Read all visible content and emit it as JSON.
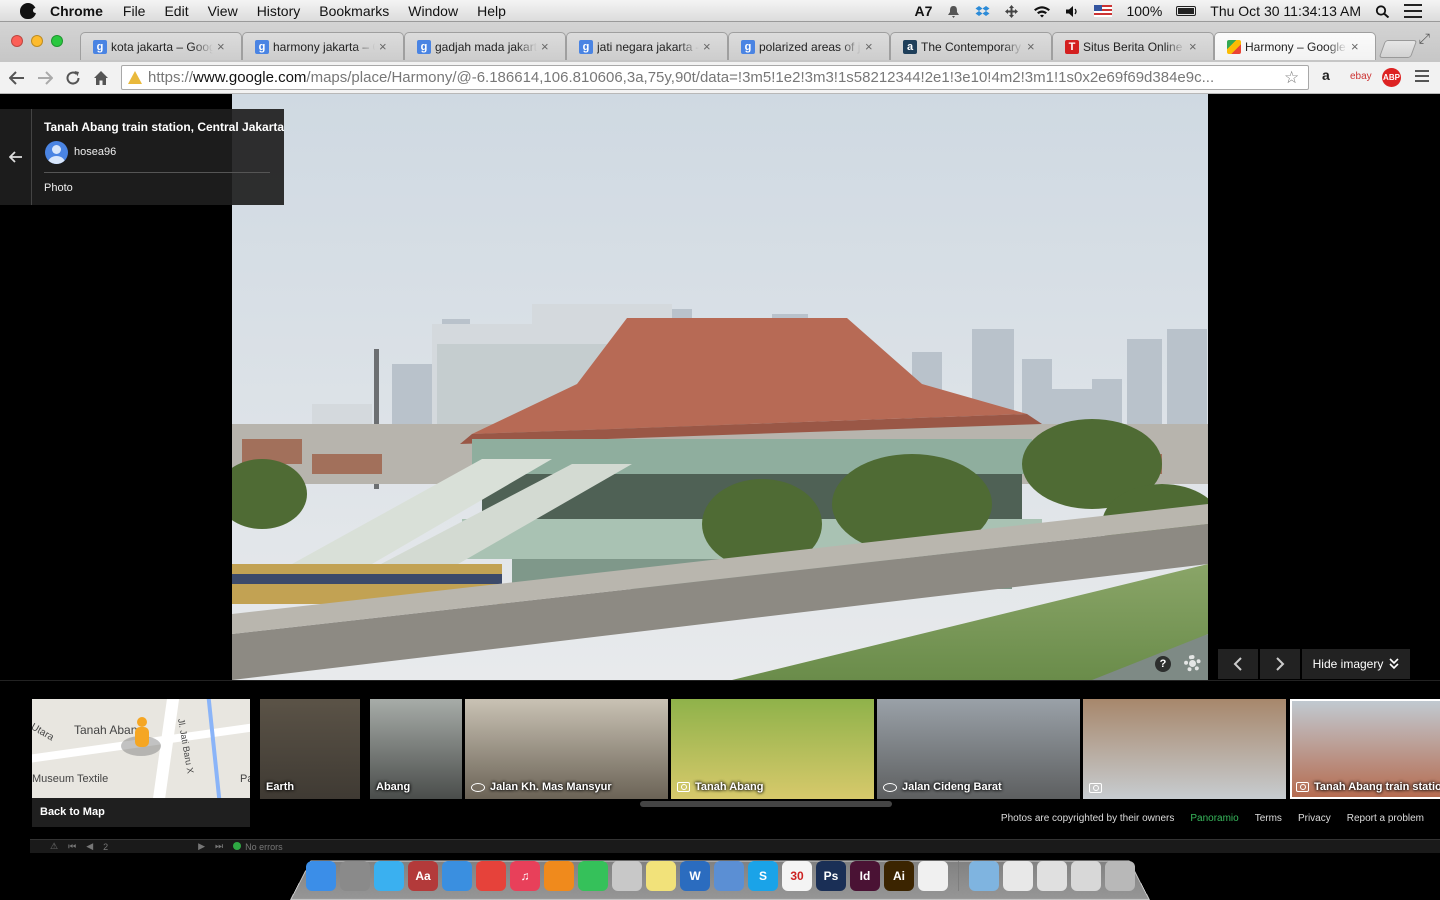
{
  "menubar": {
    "app": "Chrome",
    "items": [
      "File",
      "Edit",
      "View",
      "History",
      "Bookmarks",
      "Window",
      "Help"
    ],
    "adobe_badge": "7",
    "battery": "100%",
    "clock": "Thu Oct 30  11:34:13 AM"
  },
  "tabs": [
    {
      "title": "kota jakarta – Googl",
      "icon": "google-g-icon",
      "active": false
    },
    {
      "title": "harmony jakarta – G",
      "icon": "google-g-icon",
      "active": false
    },
    {
      "title": "gadjah mada jakarta",
      "icon": "google-g-icon",
      "active": false
    },
    {
      "title": "jati negara jakarta –",
      "icon": "google-g-icon",
      "active": false
    },
    {
      "title": "polarized areas of ja",
      "icon": "google-g-icon",
      "active": false
    },
    {
      "title": "The Contemporary U",
      "icon": "academia-a-icon",
      "active": false
    },
    {
      "title": "Situs Berita Online In",
      "icon": "tempo-t-icon",
      "active": false
    },
    {
      "title": "Harmony – Google M",
      "icon": "google-maps-icon",
      "active": true
    }
  ],
  "toolbar": {
    "url_scheme": "https://",
    "url_host": "www.google.com",
    "url_rest": "/maps/place/Harmony/@-6.186614,106.810606,3a,75y,90t/data=!3m5!1e2!3m3!1s58212344!2e1!3e10!4m2!3m1!1s0x2e69f69d384e9c...",
    "ext_amazon": "a",
    "ext_ebay": "ebay",
    "ext_abp": "ABP"
  },
  "photo_card": {
    "place": "Tanah Abang train station, Central Jakarta",
    "user": "hosea96",
    "type": "Photo"
  },
  "viewer_controls": {
    "help": "?",
    "hide_imagery": "Hide imagery"
  },
  "minimap": {
    "label_station": "Tanah Aban",
    "label_museum": "Museum Textile",
    "label_road": "Jl. Jati Baru X",
    "label_utara": "Utara",
    "label_pa": "Pa",
    "back_to_map": "Back to Map"
  },
  "thumbnails": [
    {
      "caption": "Earth",
      "icon": "none",
      "colors": [
        "#5b5347",
        "#3f3a33"
      ]
    },
    {
      "caption": "Abang",
      "icon": "none",
      "colors": [
        "#a7aca8",
        "#4a4d4b"
      ]
    },
    {
      "caption": "Jalan Kh. Mas Mansyur",
      "icon": "eye",
      "colors": [
        "#c9c2b4",
        "#6b6356"
      ]
    },
    {
      "caption": "Tanah Abang",
      "icon": "camera",
      "colors": [
        "#8fb24a",
        "#d7c96b"
      ]
    },
    {
      "caption": "Jalan Cideng Barat",
      "icon": "eye",
      "colors": [
        "#9aa1a8",
        "#5d5f60"
      ]
    },
    {
      "caption": "",
      "icon": "camera",
      "colors": [
        "#a7876b",
        "#c7ccd0"
      ]
    },
    {
      "caption": "Tanah Abang train statio",
      "icon": "camera",
      "colors": [
        "#c1cbd3",
        "#b56a4e"
      ]
    }
  ],
  "legal": {
    "copyright": "Photos are copyrighted by their owners",
    "panoramio": "Panoramio",
    "terms": "Terms",
    "privacy": "Privacy",
    "report": "Report a problem"
  },
  "devstrip": {
    "page": "2",
    "status": "No errors"
  },
  "dock": [
    {
      "name": "finder-icon",
      "label": "",
      "color": "#3b8ee8"
    },
    {
      "name": "system-preferences-icon",
      "label": "",
      "color": "#8a8a8a"
    },
    {
      "name": "messages-icon",
      "label": "",
      "color": "#3ab0f0"
    },
    {
      "name": "dictionary-icon",
      "label": "Aa",
      "color": "#b33a3a"
    },
    {
      "name": "safari-icon",
      "label": "",
      "color": "#3a8fe0"
    },
    {
      "name": "chrome-icon",
      "label": "",
      "color": "#e6423a"
    },
    {
      "name": "itunes-icon",
      "label": "♫",
      "color": "#e8405a"
    },
    {
      "name": "ibooks-icon",
      "label": "",
      "color": "#f08a1c"
    },
    {
      "name": "spotify-icon",
      "label": "",
      "color": "#35c15a"
    },
    {
      "name": "calculator-icon",
      "label": "",
      "color": "#c8c8c8"
    },
    {
      "name": "stickies-icon",
      "label": "",
      "color": "#f2e27a"
    },
    {
      "name": "word-icon",
      "label": "W",
      "color": "#2b6cbf"
    },
    {
      "name": "fetch-icon",
      "label": "",
      "color": "#5b8fd4"
    },
    {
      "name": "skype-icon",
      "label": "S",
      "color": "#1aa3e8"
    },
    {
      "name": "calendar-icon",
      "label": "30",
      "color": "#f4f4f4"
    },
    {
      "name": "photoshop-icon",
      "label": "Ps",
      "color": "#1a2f56"
    },
    {
      "name": "indesign-icon",
      "label": "Id",
      "color": "#4a1234"
    },
    {
      "name": "illustrator-icon",
      "label": "Ai",
      "color": "#3b2400"
    },
    {
      "name": "acrobat-icon",
      "label": "",
      "color": "#f0f0f0"
    },
    {
      "name": "applications-folder-icon",
      "label": "",
      "color": "#7fb4e0"
    },
    {
      "name": "pdf-stack-icon",
      "label": "",
      "color": "#e8e8e8"
    },
    {
      "name": "documents-stack-icon",
      "label": "",
      "color": "#e0e0e0"
    },
    {
      "name": "downloads-stack-icon",
      "label": "",
      "color": "#d8d8d8"
    },
    {
      "name": "trash-icon",
      "label": "",
      "color": "#b8b8b8"
    }
  ]
}
